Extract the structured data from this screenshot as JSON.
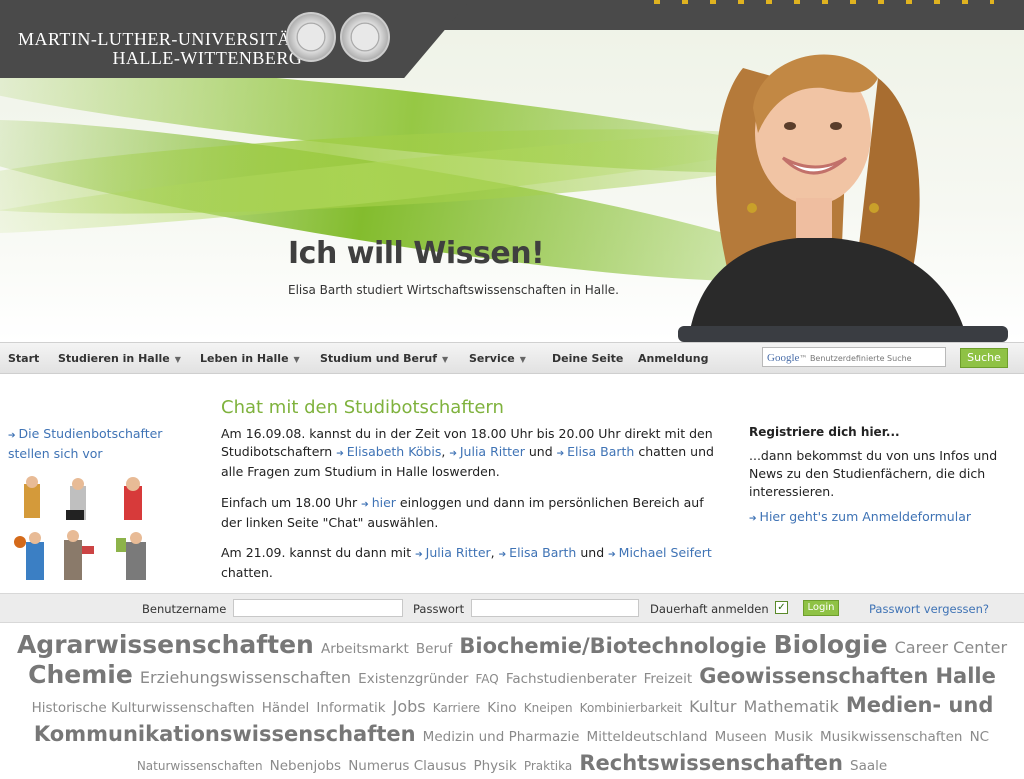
{
  "header": {
    "university_line1": "MARTIN-LUTHER-UNIVERSITÄT",
    "university_line2": "HALLE-WITTENBERG",
    "hero_title": "Ich will Wissen!",
    "hero_subtitle": "Elisa Barth studiert Wirtschaftswissenschaften in Halle."
  },
  "nav": {
    "items": [
      {
        "label": "Start",
        "dropdown": false
      },
      {
        "label": "Studieren in Halle",
        "dropdown": true
      },
      {
        "label": "Leben in Halle",
        "dropdown": true
      },
      {
        "label": "Studium und Beruf",
        "dropdown": true
      },
      {
        "label": "Service",
        "dropdown": true
      },
      {
        "label": "Deine Seite",
        "dropdown": false
      },
      {
        "label": "Anmeldung",
        "dropdown": false
      }
    ],
    "search_brand": "Google",
    "search_placeholder": "Benutzerdefinierte Suche",
    "search_button": "Suche"
  },
  "left": {
    "link_text": "Die Studienbotschafter stellen sich vor"
  },
  "chat": {
    "title": "Chat mit den Studibotschaftern",
    "p1_a": "Am 16.09.08. kannst du in der Zeit von 18.00 Uhr bis 20.00 Uhr direkt mit den Studibotschaftern",
    "p1_link1": "Elisabeth Köbis",
    "p1_sep1": ",",
    "p1_link2": "Julia Ritter",
    "p1_and": "und",
    "p1_link3": "Elisa Barth",
    "p1_b": "chatten und alle Fragen zum Studium in Halle loswerden.",
    "p2_a": "Einfach um 18.00 Uhr",
    "p2_link": "hier",
    "p2_b": "einloggen und dann im persönlichen Bereich auf der linken Seite \"Chat\" auswählen.",
    "p3_a": "Am 21.09. kannst du dann mit",
    "p3_link1": "Julia Ritter",
    "p3_sep1": ",",
    "p3_link2": "Elisa Barth",
    "p3_and": "und",
    "p3_link3": "Michael Seifert",
    "p3_b": "chatten."
  },
  "register": {
    "title": "Registriere dich hier...",
    "text": "...dann bekommst du von uns Infos und News zu den Studienfächern, die dich interessieren.",
    "link": "Hier geht's zum Anmeldeformular"
  },
  "login": {
    "username_label": "Benutzername",
    "password_label": "Passwort",
    "remember_label": "Dauerhaft anmelden",
    "remember_checked": true,
    "check_mark": "✓",
    "button": "Login",
    "forgot": "Passwort vergessen?"
  },
  "tagcloud": [
    {
      "label": "Agrarwissenschaften",
      "size": 6
    },
    {
      "label": "Arbeitsmarkt",
      "size": 2
    },
    {
      "label": "Beruf",
      "size": 2
    },
    {
      "label": "Biochemie/Biotechnologie",
      "size": 5
    },
    {
      "label": "Biologie",
      "size": 6
    },
    {
      "label": "Career Center",
      "size": 3
    },
    {
      "label": "Chemie",
      "size": 6
    },
    {
      "label": "Erziehungswissenschaften",
      "size": 3
    },
    {
      "label": "Existenzgründer",
      "size": 2
    },
    {
      "label": "FAQ",
      "size": 1
    },
    {
      "label": "Fachstudienberater",
      "size": 2
    },
    {
      "label": "Freizeit",
      "size": 2
    },
    {
      "label": "Geowissenschaften",
      "size": 5
    },
    {
      "label": "Halle",
      "size": 5
    },
    {
      "label": "Historische Kulturwissenschaften",
      "size": 2
    },
    {
      "label": "Händel",
      "size": 2
    },
    {
      "label": "Informatik",
      "size": 2
    },
    {
      "label": "Jobs",
      "size": 3
    },
    {
      "label": "Karriere",
      "size": 1
    },
    {
      "label": "Kino",
      "size": 2
    },
    {
      "label": "Kneipen",
      "size": 1
    },
    {
      "label": "Kombinierbarkeit",
      "size": 1
    },
    {
      "label": "Kultur",
      "size": 3
    },
    {
      "label": "Mathematik",
      "size": 3
    },
    {
      "label": "Medien- und Kommunikationswissenschaften",
      "size": 5
    },
    {
      "label": "Medizin und Pharmazie",
      "size": 2
    },
    {
      "label": "Mitteldeutschland",
      "size": 2
    },
    {
      "label": "Museen",
      "size": 2
    },
    {
      "label": "Musik",
      "size": 2
    },
    {
      "label": "Musikwissenschaften",
      "size": 2
    },
    {
      "label": "NC",
      "size": 2
    },
    {
      "label": "Naturwissenschaften",
      "size": 1
    },
    {
      "label": "Nebenjobs",
      "size": 2
    },
    {
      "label": "Numerus Clausus",
      "size": 2
    },
    {
      "label": "Physik",
      "size": 2
    },
    {
      "label": "Praktika",
      "size": 1
    },
    {
      "label": "Rechtswissenschaften",
      "size": 5
    },
    {
      "label": "Saale",
      "size": 2
    }
  ],
  "colors": {
    "accent_green": "#8fc245",
    "link_blue": "#3f73b5",
    "header_dark": "#4a4a4a"
  }
}
